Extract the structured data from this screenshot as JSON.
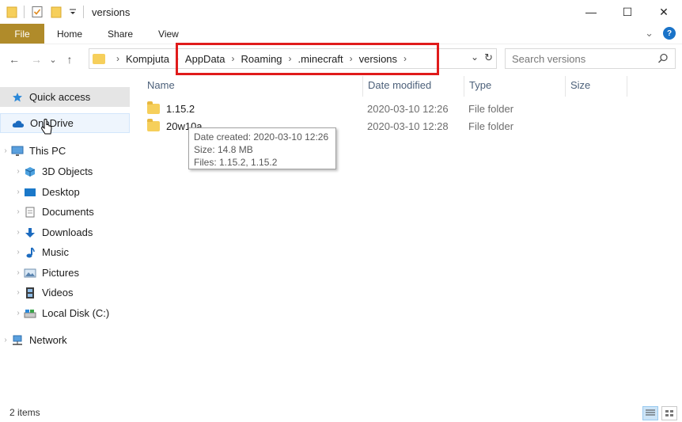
{
  "window": {
    "title": "versions",
    "minimize": "—",
    "maximize": "☐",
    "close": "✕"
  },
  "ribbon": {
    "tabs": [
      "File",
      "Home",
      "Share",
      "View"
    ],
    "expand_glyph": "⌄",
    "help_glyph": "?"
  },
  "nav": {
    "back": "←",
    "forward": "→",
    "recent": "⌄",
    "up": "↑"
  },
  "address": {
    "crumbs": [
      "Kompjuta",
      "AppData",
      "Roaming",
      ".minecraft",
      "versions"
    ],
    "separator": "›",
    "dropdown": "⌄",
    "refresh": "↻"
  },
  "search": {
    "placeholder": "Search versions",
    "icon": "search-icon"
  },
  "sidebar": {
    "items": [
      {
        "label": "Quick access",
        "icon": "star-icon",
        "state": "selected"
      },
      {
        "label": "OneDrive",
        "icon": "cloud-icon",
        "state": "hover"
      },
      {
        "label": "This PC",
        "icon": "monitor-icon",
        "state": "normal"
      },
      {
        "label": "3D Objects",
        "icon": "cube-icon",
        "state": "normal"
      },
      {
        "label": "Desktop",
        "icon": "desktop-icon",
        "state": "normal"
      },
      {
        "label": "Documents",
        "icon": "document-icon",
        "state": "normal"
      },
      {
        "label": "Downloads",
        "icon": "download-arrow-icon",
        "state": "normal"
      },
      {
        "label": "Music",
        "icon": "music-note-icon",
        "state": "normal"
      },
      {
        "label": "Pictures",
        "icon": "picture-icon",
        "state": "normal"
      },
      {
        "label": "Videos",
        "icon": "film-icon",
        "state": "normal"
      },
      {
        "label": "Local Disk (C:)",
        "icon": "disk-icon",
        "state": "normal"
      },
      {
        "label": "Network",
        "icon": "network-icon",
        "state": "normal"
      }
    ]
  },
  "columns": {
    "name": "Name",
    "date": "Date modified",
    "type": "Type",
    "size": "Size"
  },
  "files": [
    {
      "name": "1.15.2",
      "date": "2020-03-10 12:26",
      "type": "File folder"
    },
    {
      "name": "20w10a",
      "date": "2020-03-10 12:28",
      "type": "File folder"
    }
  ],
  "tooltip": {
    "line1": "Date created: 2020-03-10 12:26",
    "line2": "Size: 14.8 MB",
    "line3": "Files: 1.15.2, 1.15.2"
  },
  "status": {
    "count": "2 items"
  },
  "colors": {
    "file_tab": "#b08b2a",
    "highlight": "#e01b1b",
    "folder": "#f6cf5b",
    "header_text": "#4c607a"
  }
}
